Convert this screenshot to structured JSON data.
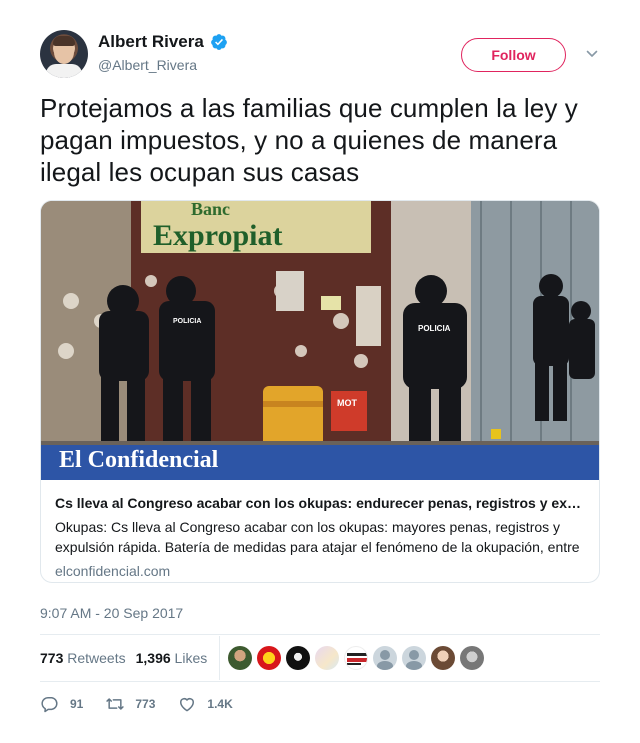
{
  "author": {
    "display_name": "Albert Rivera",
    "handle": "@Albert_Rivera",
    "verified": true
  },
  "follow_label": "Follow",
  "tweet_text": "Protejamos a las familias que cumplen la ley y pagan impuestos, y no a quienes de manera ilegal les ocupan sus casas",
  "card": {
    "image_sign_text": "Expropiat",
    "image_sign_text_partial": "Banc",
    "image_vest_text": "POLICIA",
    "image_barrel_text": "MOT",
    "logo_text": "El Confidencial",
    "title": "Cs lleva al Congreso acabar con los okupas: endurecer penas, registros y expulsión rápida",
    "description": "Okupas: Cs lleva al Congreso acabar con los okupas: mayores penas, registros y expulsión rápida. Batería de medidas para atajar el fenómeno de la okupación, entre otras...",
    "domain": "elconfidencial.com"
  },
  "timestamp": "9:07 AM - 20 Sep 2017",
  "stats": {
    "retweets_count": "773",
    "retweets_label": "Retweets",
    "likes_count": "1,396",
    "likes_label": "Likes"
  },
  "liker_avatars": [
    "avatar-1",
    "avatar-2",
    "avatar-3",
    "avatar-4",
    "avatar-5",
    "avatar-6",
    "avatar-7",
    "avatar-8",
    "avatar-9"
  ],
  "liker_avatar_text": "LA ESPAÑA QUE NO SE RINDE",
  "actions": {
    "reply_count": "91",
    "retweet_count": "773",
    "like_count": "1.4K"
  },
  "colors": {
    "accent": "#e0245e",
    "verified": "#1da1f2",
    "muted": "#657786",
    "logo_bar": "#2d55a6"
  }
}
